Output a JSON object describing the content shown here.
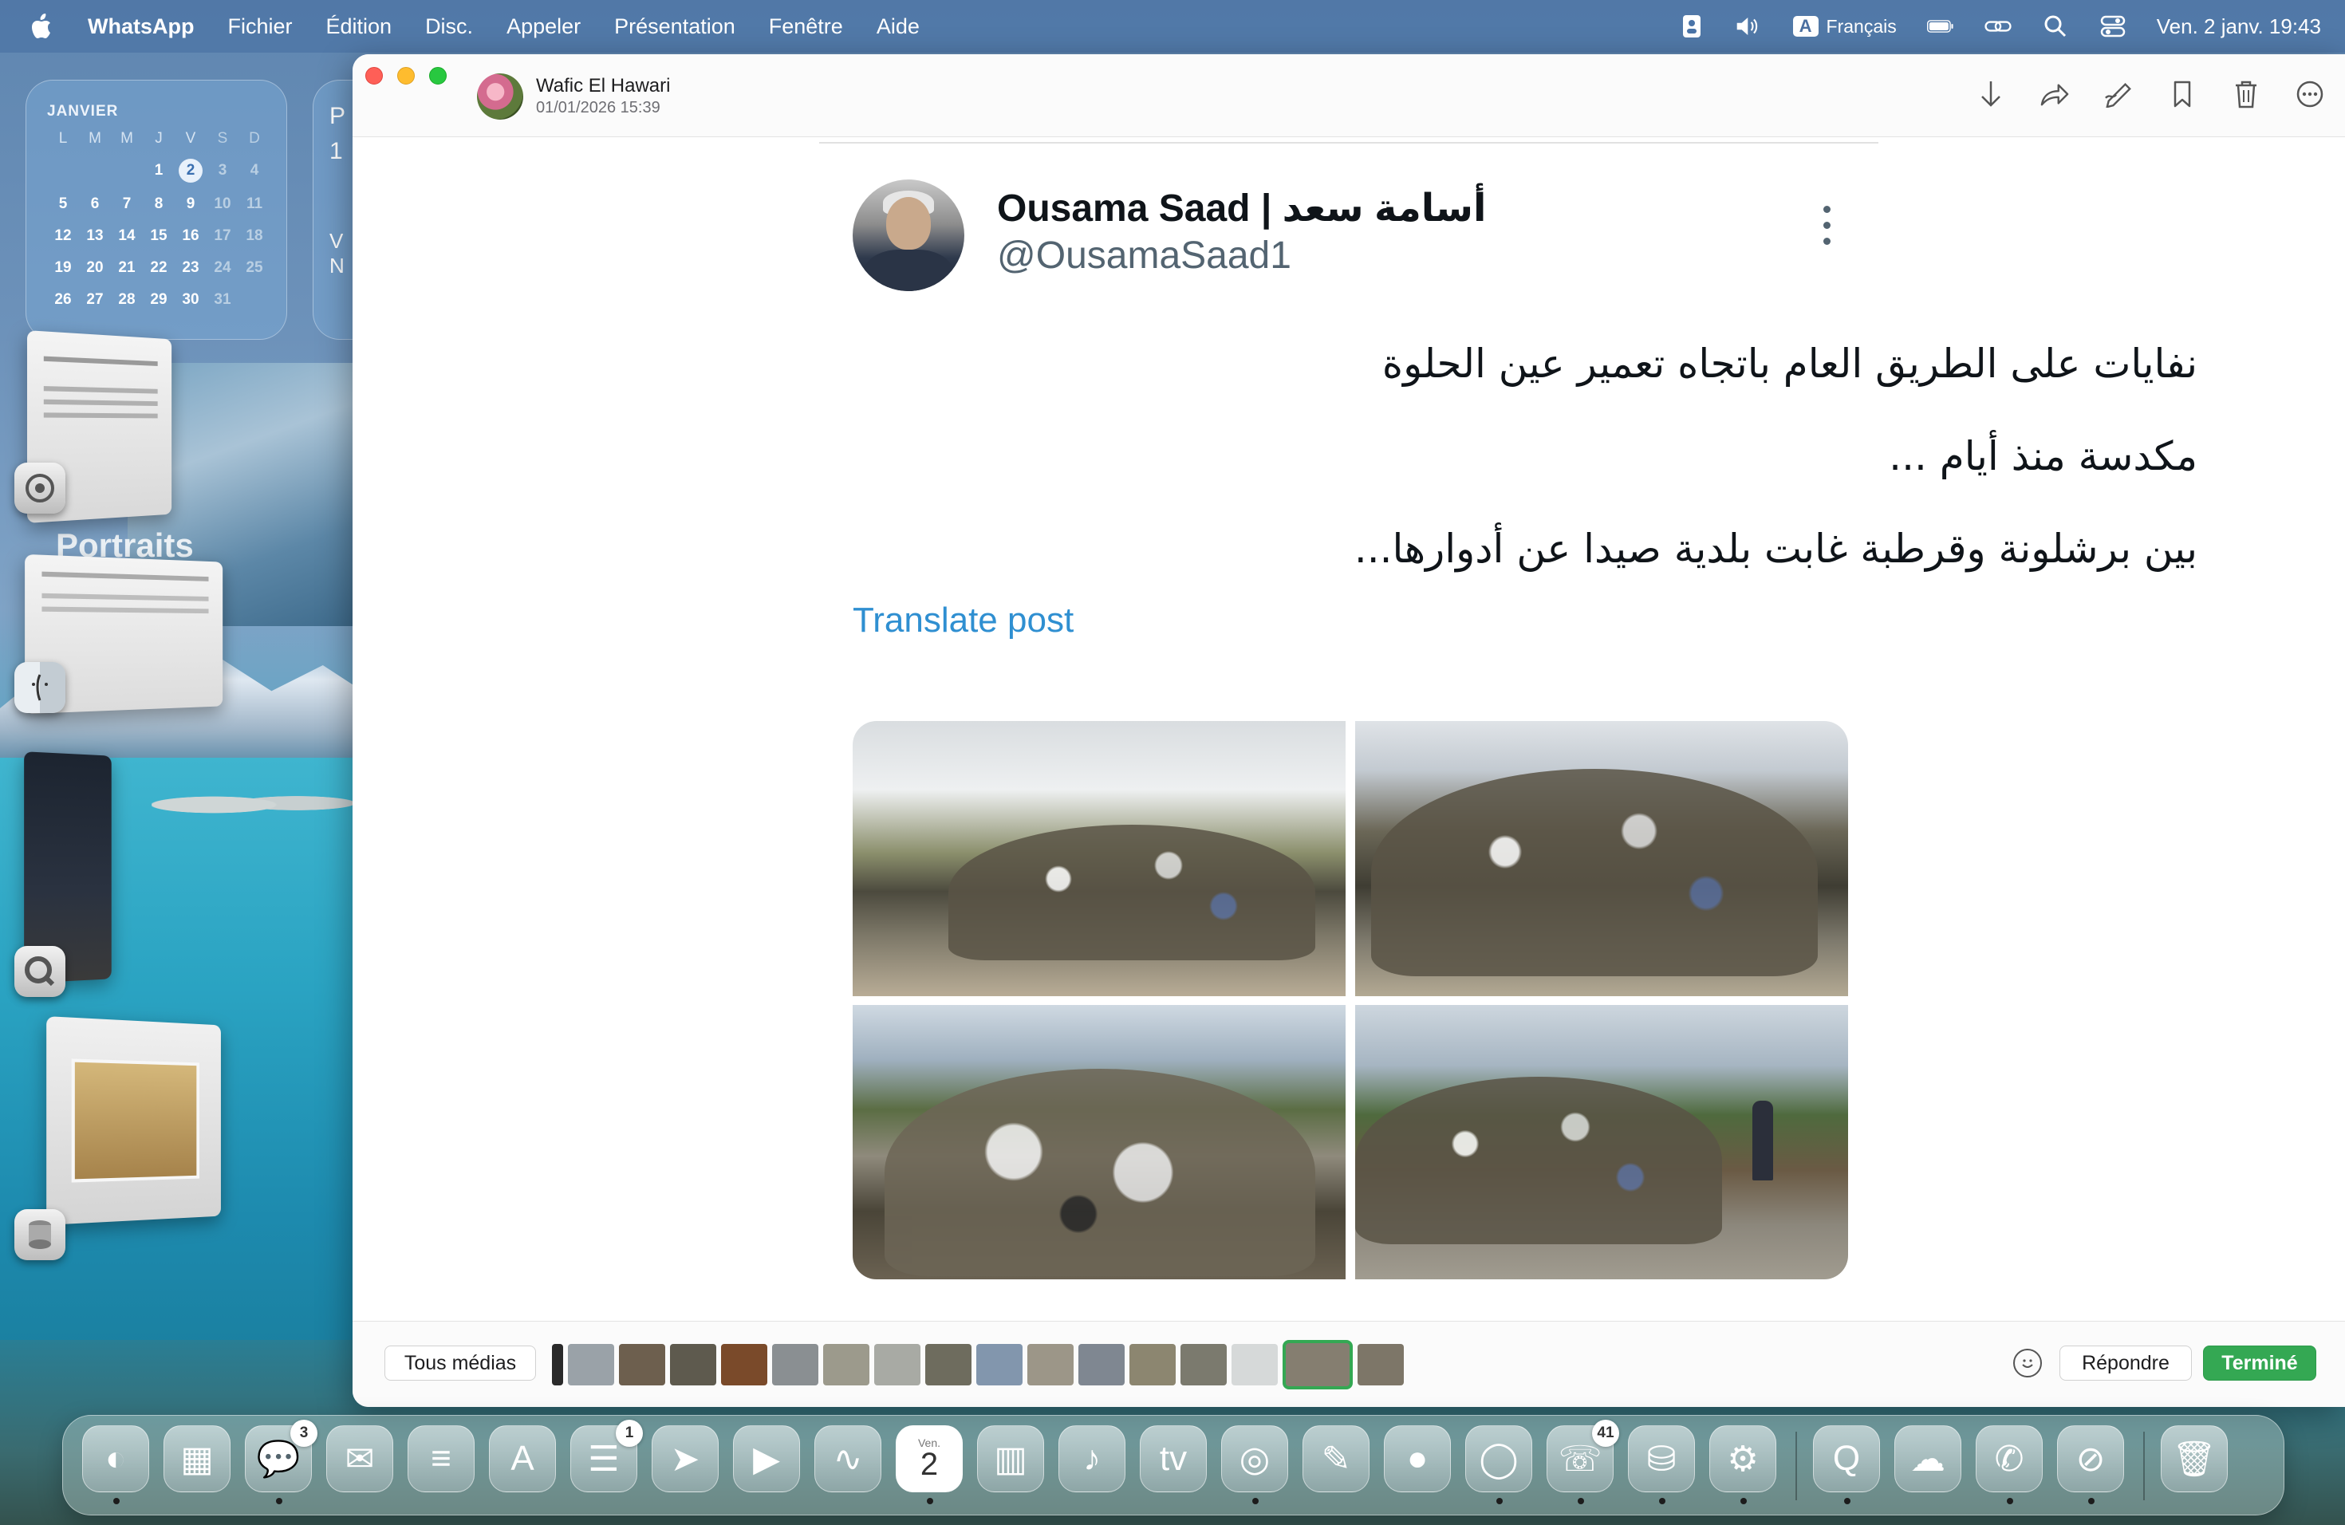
{
  "menubar": {
    "app_name": "WhatsApp",
    "items": [
      "Fichier",
      "Édition",
      "Disc.",
      "Appeler",
      "Présentation",
      "Fenêtre",
      "Aide"
    ],
    "keyboard_badge": "A",
    "language": "Français",
    "datetime": "Ven. 2 janv. 19:43"
  },
  "calendar_widget": {
    "month": "JANVIER",
    "weekdays": [
      "L",
      "M",
      "M",
      "J",
      "V",
      "S",
      "D"
    ],
    "days": [
      "",
      "",
      "",
      "1",
      "2",
      "3",
      "4",
      "5",
      "6",
      "7",
      "8",
      "9",
      "10",
      "11",
      "12",
      "13",
      "14",
      "15",
      "16",
      "17",
      "18",
      "19",
      "20",
      "21",
      "22",
      "23",
      "24",
      "25",
      "26",
      "27",
      "28",
      "29",
      "30",
      "31"
    ],
    "today": "2"
  },
  "side_widget": {
    "letters": [
      "P",
      "1",
      "V",
      "N"
    ]
  },
  "stage_manager": {
    "portraits_label": "Portraits"
  },
  "viewer": {
    "sender_name": "Wafic El Hawari",
    "sender_date": "01/01/2026 15:39",
    "toolbar_icons": [
      "download-icon",
      "share-icon",
      "markup-icon",
      "bookmark-icon",
      "trash-icon",
      "more-icon"
    ]
  },
  "tweet": {
    "name": "Ousama Saad | أسامة سعد",
    "handle": "@OusamaSaad1",
    "lines": [
      "نفايات على الطريق العام باتجاه تعمير عين الحلوة",
      "مكدسة منذ أيام ...",
      "بين برشلونة وقرطبة غابت بلدية صيدا عن أدوارها..."
    ],
    "translate": "Translate post",
    "media_count": 4
  },
  "bottombar": {
    "all_media": "Tous médias",
    "reply": "Répondre",
    "done": "Terminé",
    "thumbnail_count": 17,
    "selected_thumbnail": 15
  },
  "dock": {
    "apps": [
      {
        "name": "finder",
        "badge": ""
      },
      {
        "name": "launchpad",
        "badge": ""
      },
      {
        "name": "messages",
        "badge": "3"
      },
      {
        "name": "mail",
        "badge": ""
      },
      {
        "name": "notes",
        "badge": ""
      },
      {
        "name": "app-store",
        "badge": ""
      },
      {
        "name": "reminders",
        "badge": "1"
      },
      {
        "name": "maps",
        "badge": ""
      },
      {
        "name": "facetime",
        "badge": ""
      },
      {
        "name": "freeform",
        "badge": ""
      },
      {
        "name": "calendar",
        "badge": ""
      },
      {
        "name": "numbers",
        "badge": ""
      },
      {
        "name": "music",
        "badge": ""
      },
      {
        "name": "tv",
        "badge": ""
      },
      {
        "name": "chrome",
        "badge": ""
      },
      {
        "name": "pages",
        "badge": ""
      },
      {
        "name": "contacts",
        "badge": ""
      },
      {
        "name": "signal",
        "badge": ""
      },
      {
        "name": "whatsapp",
        "badge": "41"
      },
      {
        "name": "disk-utility",
        "badge": ""
      },
      {
        "name": "system-settings",
        "badge": ""
      },
      {
        "name": "quicktime",
        "badge": ""
      },
      {
        "name": "icloud",
        "badge": ""
      },
      {
        "name": "phone",
        "badge": ""
      },
      {
        "name": "safari",
        "badge": ""
      },
      {
        "name": "trash",
        "badge": ""
      }
    ],
    "calendar_icon_day": "Ven.",
    "calendar_icon_date": "2"
  },
  "colors": {
    "accent_green": "#34a853",
    "link_blue": "#2f8fd1",
    "menubar": "#4a74a8"
  }
}
